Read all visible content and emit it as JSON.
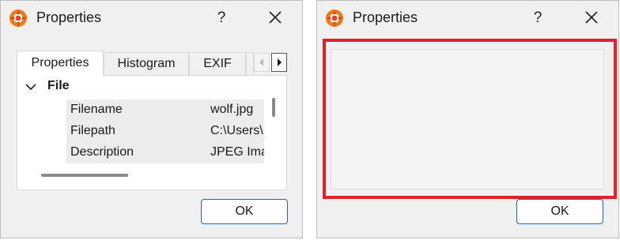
{
  "left_dialog": {
    "title": "Properties",
    "help_label": "?",
    "tabs": [
      {
        "label": "Properties",
        "active": true
      },
      {
        "label": "Histogram",
        "active": false
      },
      {
        "label": "EXIF",
        "active": false
      }
    ],
    "tree": {
      "group_label": "File",
      "rows": [
        {
          "name": "Filename",
          "value": "wolf.jpg"
        },
        {
          "name": "Filepath",
          "value": "C:\\Users\\"
        },
        {
          "name": "Description",
          "value": "JPEG Image"
        }
      ]
    },
    "ok_label": "OK"
  },
  "right_dialog": {
    "title": "Properties",
    "help_label": "?",
    "ok_label": "OK"
  },
  "colors": {
    "dialog_background": "#f0f0f0",
    "ok_button_border": "#1f67b8",
    "highlight_border": "#e0202a",
    "icon_orange": "#f07a1a"
  },
  "icons": {
    "app": "xnview-app-icon",
    "close": "close-icon",
    "expand": "chevron-down-icon",
    "tab_prev": "chevron-left-icon",
    "tab_next": "chevron-right-icon"
  }
}
